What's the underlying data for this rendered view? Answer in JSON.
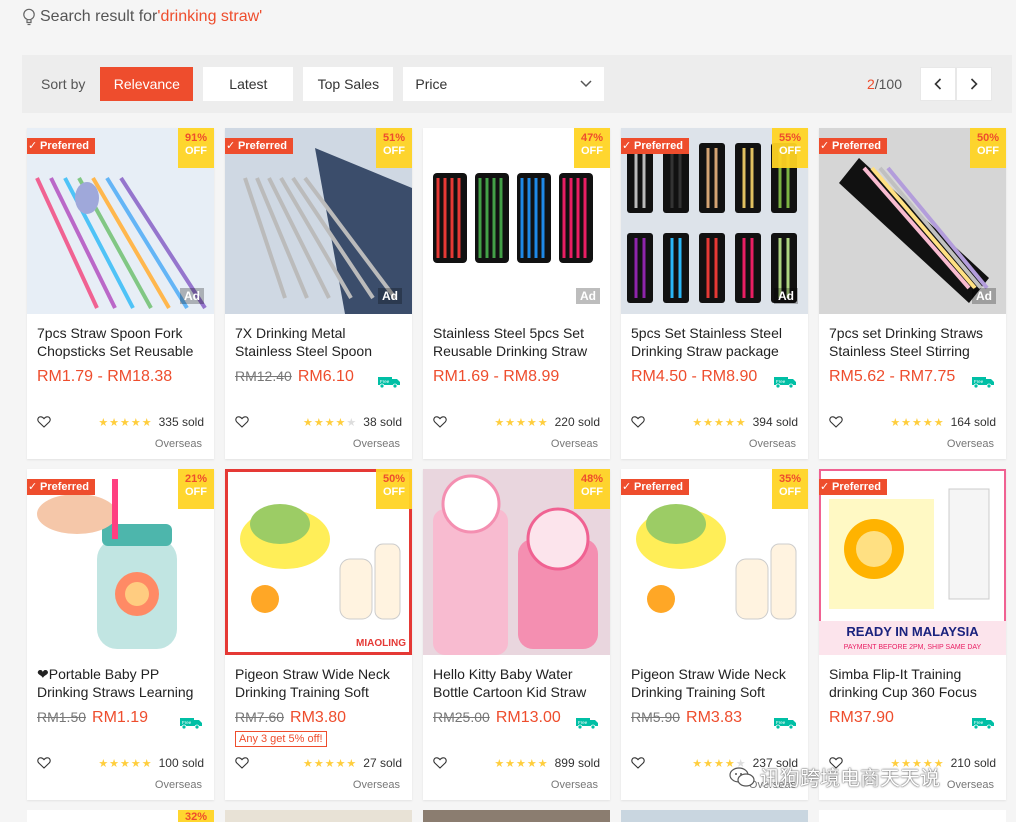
{
  "search": {
    "prefix": "Search result for ",
    "keyword": "'drinking straw'"
  },
  "sortbar": {
    "label": "Sort by",
    "buttons": [
      "Relevance",
      "Latest",
      "Top Sales"
    ],
    "price": "Price",
    "page_current": "2",
    "page_total": "/100"
  },
  "badges": {
    "preferred": "Preferred",
    "ad": "Ad",
    "off": "OFF",
    "overseas": "Overseas"
  },
  "products": [
    {
      "name": "7pcs Straw Spoon Fork Chopsticks Set Reusable Tableware",
      "discount": "91%",
      "preferred": true,
      "ad": true,
      "orig": "",
      "price": "RM1.79 - RM18.38",
      "stars": 5,
      "sold": "335 sold",
      "free_ship": false
    },
    {
      "name": "7X Drinking Metal Stainless Steel Spoon Fork Set",
      "discount": "51%",
      "preferred": true,
      "ad": true,
      "orig": "RM12.40",
      "price": "RM6.10",
      "stars": 4,
      "sold": "38 sold",
      "free_ship": true
    },
    {
      "name": "Stainless Steel 5pcs Set Reusable Drinking Straw Set",
      "discount": "47%",
      "preferred": false,
      "ad": true,
      "orig": "",
      "price": "RM1.69 - RM8.99",
      "stars": 5,
      "sold": "220 sold",
      "free_ship": false
    },
    {
      "name": "5pcs Set Stainless Steel Drinking Straw package with bag",
      "discount": "55%",
      "preferred": true,
      "ad": true,
      "orig": "",
      "price": "RM4.50 - RM8.90",
      "stars": 5,
      "sold": "394 sold",
      "free_ship": true
    },
    {
      "name": "7pcs set Drinking Straws Stainless Steel Stirring Straw",
      "discount": "50%",
      "preferred": true,
      "ad": true,
      "orig": "",
      "price": "RM5.62 - RM7.75",
      "stars": 5,
      "sold": "164 sold",
      "free_ship": true
    },
    {
      "name": "❤Portable Baby PP Drinking Straws Learning Cup",
      "discount": "21%",
      "preferred": true,
      "ad": false,
      "orig": "RM1.50",
      "price": "RM1.19",
      "stars": 5,
      "sold": "100 sold",
      "free_ship": true
    },
    {
      "name": "Pigeon Straw Wide Neck Drinking Training Soft Spout",
      "discount": "50%",
      "preferred": false,
      "ad": false,
      "orig": "RM7.60",
      "price": "RM3.80",
      "stars": 5,
      "sold": "27 sold",
      "free_ship": false,
      "promo": "Any 3 get 5% off!",
      "brand": "MIAOLING"
    },
    {
      "name": "Hello Kitty Baby Water Bottle Cartoon Kid Straw Cup",
      "discount": "48%",
      "preferred": false,
      "ad": false,
      "orig": "RM25.00",
      "price": "RM13.00",
      "stars": 5,
      "sold": "899 sold",
      "free_ship": true
    },
    {
      "name": "Pigeon Straw Wide Neck Drinking Training Soft Spout",
      "discount": "35%",
      "preferred": true,
      "ad": false,
      "orig": "RM5.90",
      "price": "RM3.83",
      "stars": 4,
      "sold": "237 sold",
      "free_ship": true
    },
    {
      "name": "Simba Flip-It Training drinking Cup 360 Focus",
      "discount": "",
      "preferred": true,
      "ad": false,
      "orig": "",
      "price": "RM37.90",
      "stars": 5,
      "sold": "210 sold",
      "free_ship": true,
      "banner": "READY IN MALAYSIA",
      "banner_sub": "PAYMENT BEFORE 2PM, SHIP SAME DAY"
    }
  ],
  "row3_discount": "32%",
  "watermark": "讯狗跨境电商天天说",
  "colors": {
    "accent": "#ee4d2d",
    "off_bg": "#ffd424",
    "star": "#ffce3d",
    "free_ship": "#00bfa5"
  }
}
